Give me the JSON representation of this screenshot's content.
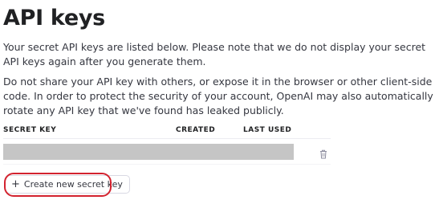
{
  "page": {
    "title": "API keys",
    "intro": "Your secret API keys are listed below. Please note that we do not display your secret API keys again after you generate them.",
    "warning": "Do not share your API key with others, or expose it in the browser or other client-side code. In order to protect the security of your account, OpenAI may also automatically rotate any API key that we've found has leaked publicly."
  },
  "table": {
    "columns": {
      "secret_key": "SECRET KEY",
      "created": "CREATED",
      "last_used": "LAST USED"
    },
    "rows": [
      {
        "secret_key": "",
        "created": "",
        "last_used": "",
        "delete_icon": "trash-icon",
        "redacted": true
      }
    ]
  },
  "actions": {
    "create_icon": "plus-icon",
    "create_label": "Create new secret key"
  },
  "colors": {
    "highlight": "#d3232f",
    "redaction": "#c5c5c5"
  }
}
